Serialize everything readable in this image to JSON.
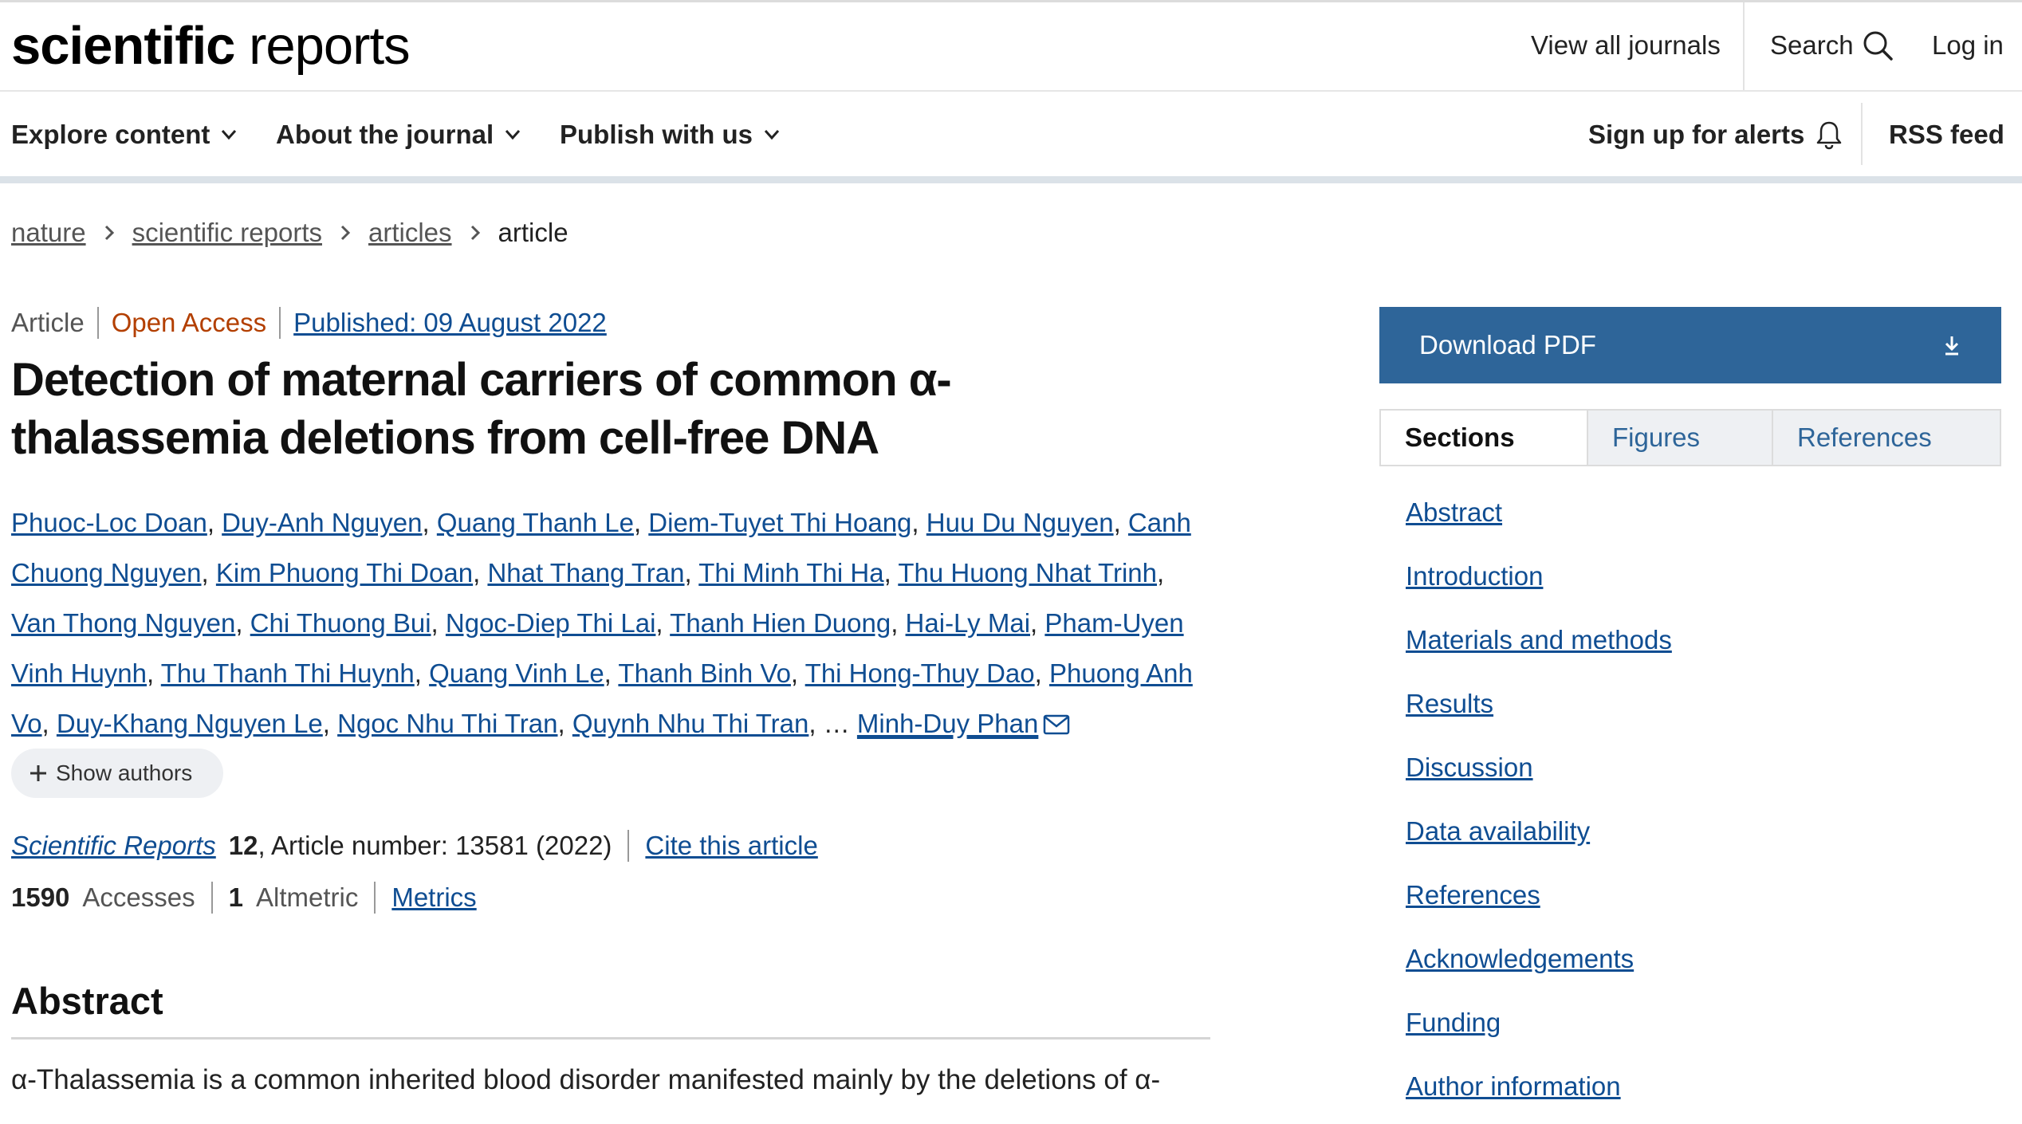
{
  "header": {
    "logo_bold": "scientific",
    "logo_light": "reports",
    "view_all": "View all journals",
    "search": "Search",
    "login": "Log in"
  },
  "nav": {
    "explore": "Explore content",
    "about": "About the journal",
    "publish": "Publish with us",
    "alerts": "Sign up for alerts",
    "rss": "RSS feed"
  },
  "breadcrumb": [
    "nature",
    "scientific reports",
    "articles",
    "article"
  ],
  "article": {
    "type": "Article",
    "access": "Open Access",
    "published": "Published: 09 August 2022",
    "title": "Detection of maternal carriers of common α-thalassemia deletions from cell-free DNA",
    "authors": [
      "Phuoc-Loc Doan",
      "Duy-Anh Nguyen",
      "Quang Thanh Le",
      "Diem-Tuyet Thi Hoang",
      "Huu Du Nguyen",
      "Canh Chuong Nguyen",
      "Kim Phuong Thi Doan",
      "Nhat Thang Tran",
      "Thi Minh Thi Ha",
      "Thu Huong Nhat Trinh",
      "Van Thong Nguyen",
      "Chi Thuong Bui",
      "Ngoc-Diep Thi Lai",
      "Thanh Hien Duong",
      "Hai-Ly Mai",
      "Pham-Uyen Vinh Huynh",
      "Thu Thanh Thi Huynh",
      "Quang Vinh Le",
      "Thanh Binh Vo",
      "Thi Hong-Thuy Dao",
      "Phuong Anh Vo",
      "Duy-Khang Nguyen Le",
      "Ngoc Nhu Thi Tran",
      "Quynh Nhu Thi Tran"
    ],
    "ellipsis": "…",
    "last_author": "Minh-Duy Phan",
    "show_authors": "Show authors",
    "journal": "Scientific Reports",
    "volume": "12",
    "article_number": ", Article number: 13581 (2022)",
    "cite": "Cite this article",
    "accesses_count": "1590",
    "accesses_label": "Accesses",
    "altmetric_count": "1",
    "altmetric_label": "Altmetric",
    "metrics": "Metrics",
    "abstract_heading": "Abstract",
    "abstract_start": "α-Thalassemia is a common inherited blood disorder manifested mainly by the deletions of α-"
  },
  "sidebar": {
    "download": "Download PDF",
    "tabs": [
      "Sections",
      "Figures",
      "References"
    ],
    "sections": [
      "Abstract",
      "Introduction",
      "Materials and methods",
      "Results",
      "Discussion",
      "Data availability",
      "References",
      "Acknowledgements",
      "Funding",
      "Author information"
    ]
  },
  "colors": {
    "link": "#0f4d92",
    "open_access": "#b33f00",
    "download_bg": "#2e6599"
  }
}
